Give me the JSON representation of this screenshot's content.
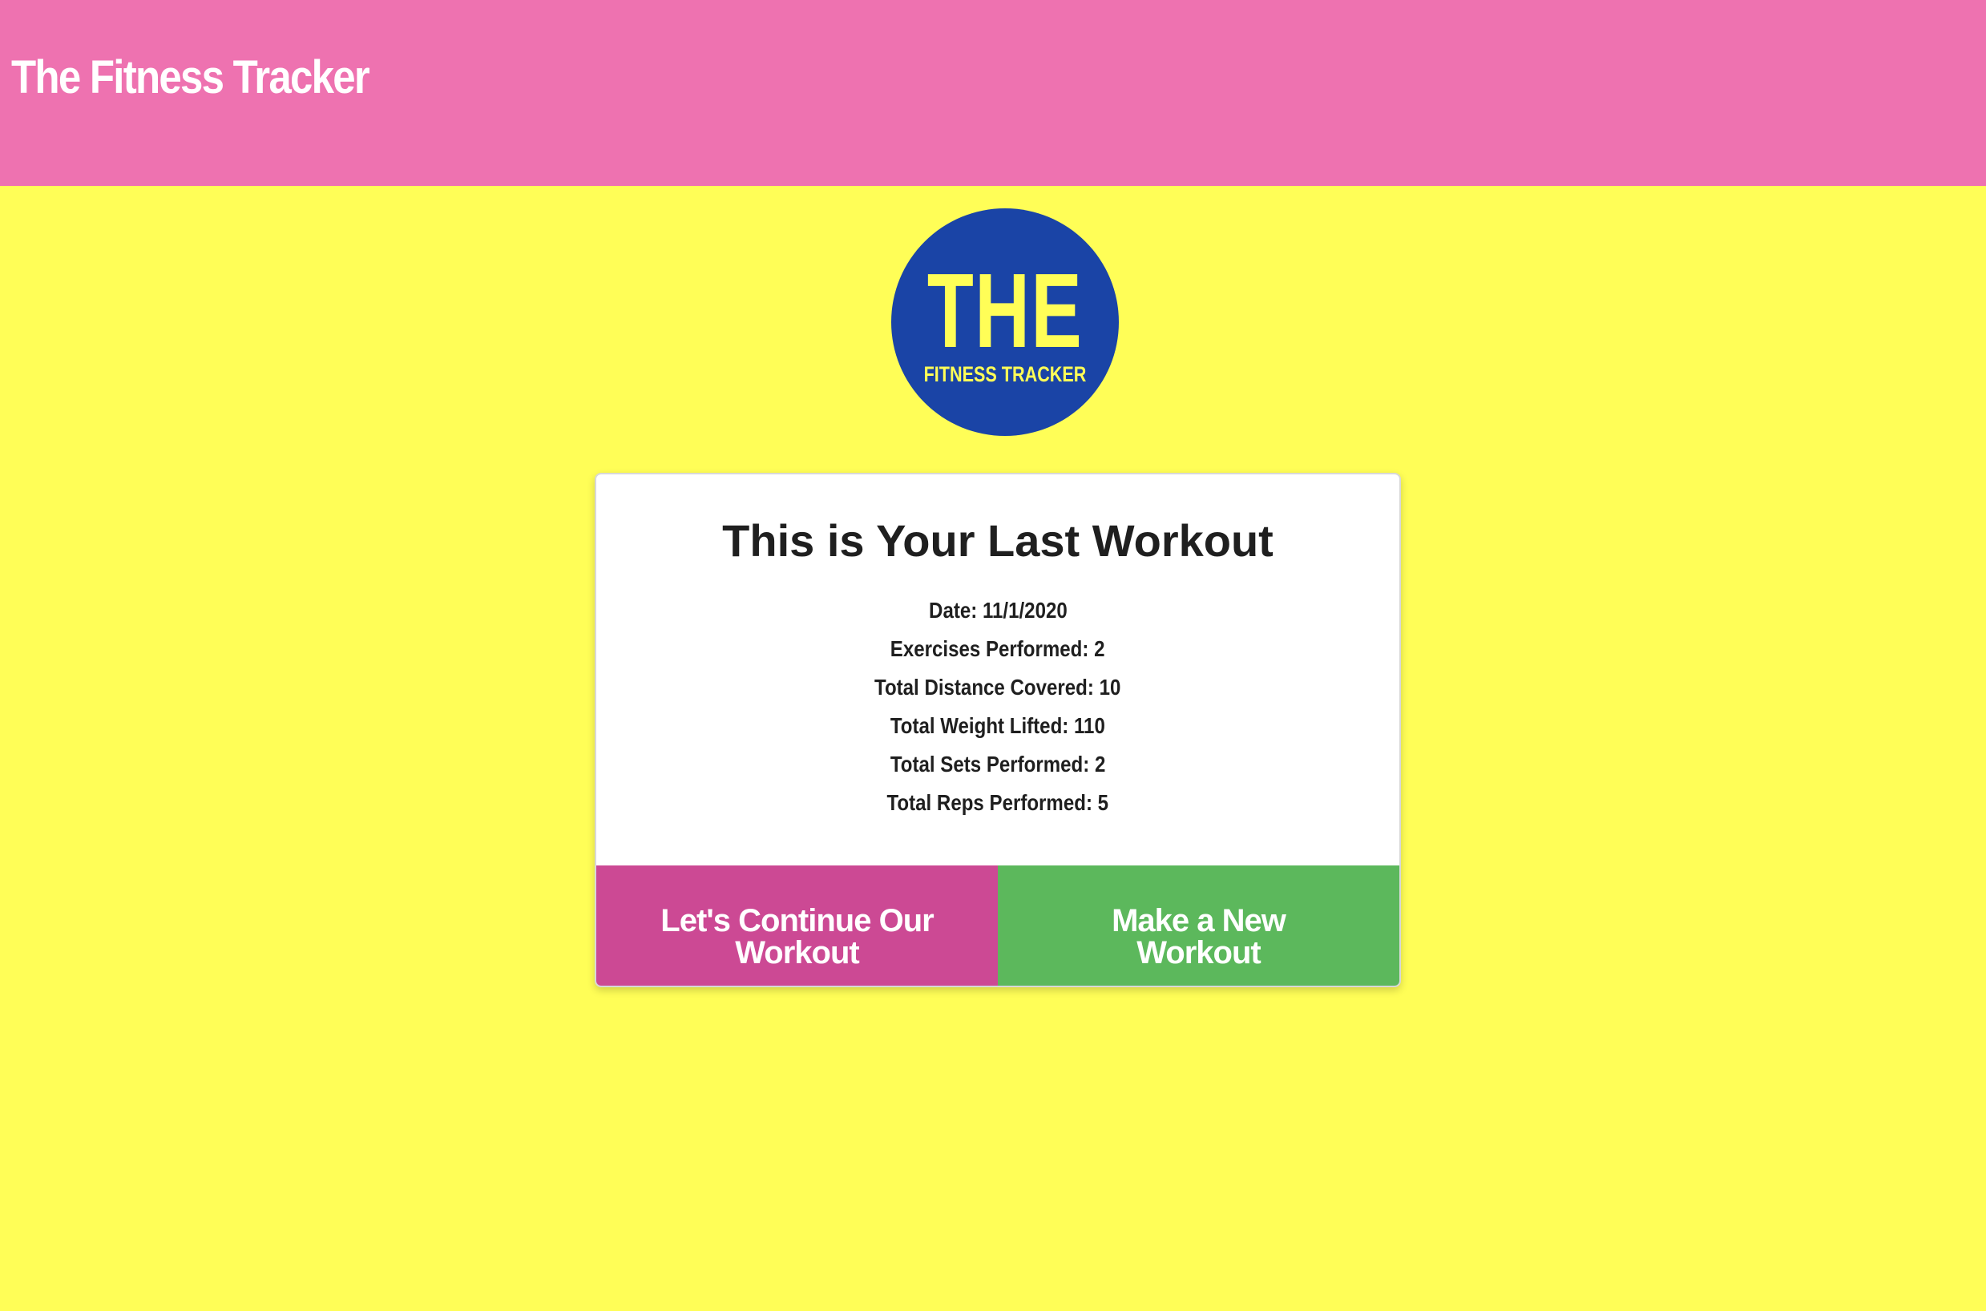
{
  "header": {
    "title": "The Fitness Tracker",
    "background": "#ee72b0"
  },
  "logo": {
    "line1": "THE",
    "line2": "FITNESS TRACKER",
    "background": "#1a44a6",
    "text_color": "#fffe57"
  },
  "card": {
    "title": "This is Your Last Workout",
    "stats": [
      "Date: 11/1/2020",
      "Exercises Performed: 2",
      "Total Distance Covered: 10",
      "Total Weight Lifted: 110",
      "Total Sets Performed: 2",
      "Total Reps Performed: 5"
    ]
  },
  "actions": {
    "continue_label": "Let's Continue Our Workout",
    "new_label": "Make a New Workout",
    "continue_color": "#cc4994",
    "new_color": "#5cb85c"
  },
  "page_background": "#fffe57"
}
